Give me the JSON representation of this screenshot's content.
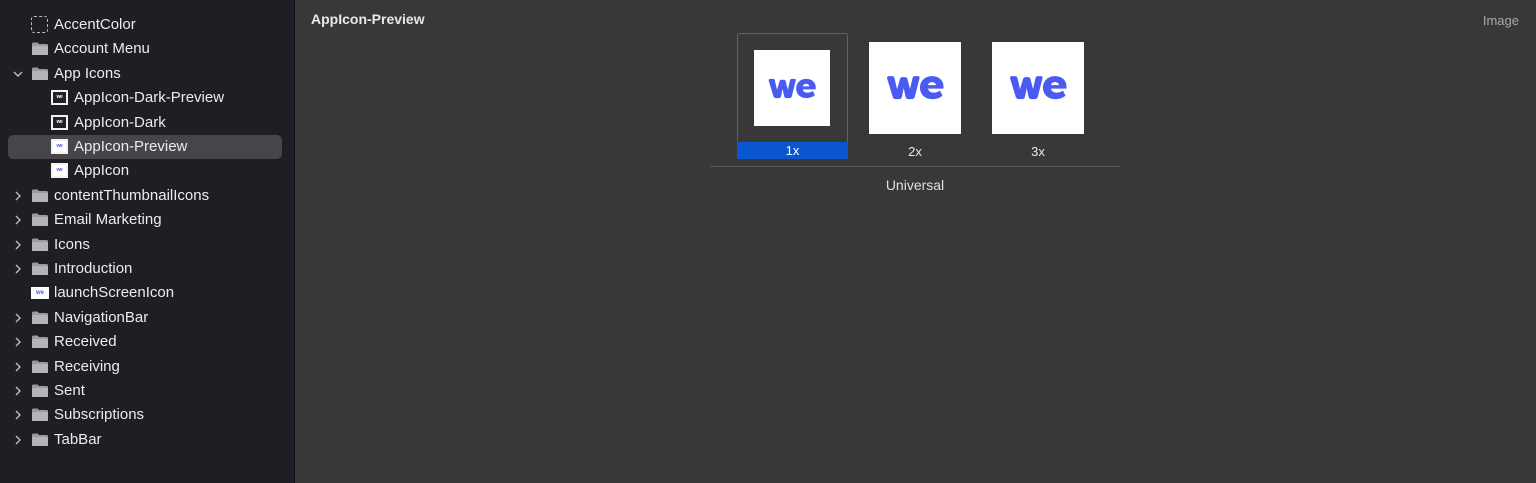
{
  "sidebar": {
    "items": [
      {
        "label": "AccentColor",
        "icon": "color-set-icon",
        "expandable": false,
        "indent": 0
      },
      {
        "label": "Account Menu",
        "icon": "folder-icon",
        "expandable": false,
        "indent": 0
      },
      {
        "label": "App Icons",
        "icon": "folder-icon",
        "expandable": true,
        "expanded": true,
        "indent": 0
      },
      {
        "label": "AppIcon-Dark-Preview",
        "icon": "image-set-dark-icon",
        "expandable": false,
        "indent": 1
      },
      {
        "label": "AppIcon-Dark",
        "icon": "image-set-dark-icon",
        "expandable": false,
        "indent": 1
      },
      {
        "label": "AppIcon-Preview",
        "icon": "image-set-icon",
        "expandable": false,
        "indent": 1,
        "selected": true
      },
      {
        "label": "AppIcon",
        "icon": "image-set-icon",
        "expandable": false,
        "indent": 1
      },
      {
        "label": "contentThumbnailIcons",
        "icon": "folder-icon",
        "expandable": true,
        "indent": 0
      },
      {
        "label": "Email Marketing",
        "icon": "folder-icon",
        "expandable": true,
        "indent": 0
      },
      {
        "label": "Icons",
        "icon": "folder-icon",
        "expandable": true,
        "indent": 0
      },
      {
        "label": "Introduction",
        "icon": "folder-icon",
        "expandable": true,
        "indent": 0
      },
      {
        "label": "launchScreenIcon",
        "icon": "image-set-wide-icon",
        "expandable": false,
        "indent": 0
      },
      {
        "label": "NavigationBar",
        "icon": "folder-icon",
        "expandable": true,
        "indent": 0
      },
      {
        "label": "Received",
        "icon": "folder-icon",
        "expandable": true,
        "indent": 0
      },
      {
        "label": "Receiving",
        "icon": "folder-icon",
        "expandable": true,
        "indent": 0
      },
      {
        "label": "Sent",
        "icon": "folder-icon",
        "expandable": true,
        "indent": 0
      },
      {
        "label": "Subscriptions",
        "icon": "folder-icon",
        "expandable": true,
        "indent": 0
      },
      {
        "label": "TabBar",
        "icon": "folder-icon",
        "expandable": true,
        "indent": 0
      }
    ]
  },
  "main": {
    "title": "AppIcon-Preview",
    "type_label": "Image",
    "slots": [
      {
        "scale": "1x",
        "selected": true
      },
      {
        "scale": "2x",
        "selected": false
      },
      {
        "scale": "3x",
        "selected": false
      }
    ],
    "group_label": "Universal",
    "logo_text": "we"
  },
  "colors": {
    "sidebar_bg": "#1f1e24",
    "main_bg": "#383838",
    "accent": "#0a56d0",
    "brand_logo": "#4a5bf2"
  }
}
